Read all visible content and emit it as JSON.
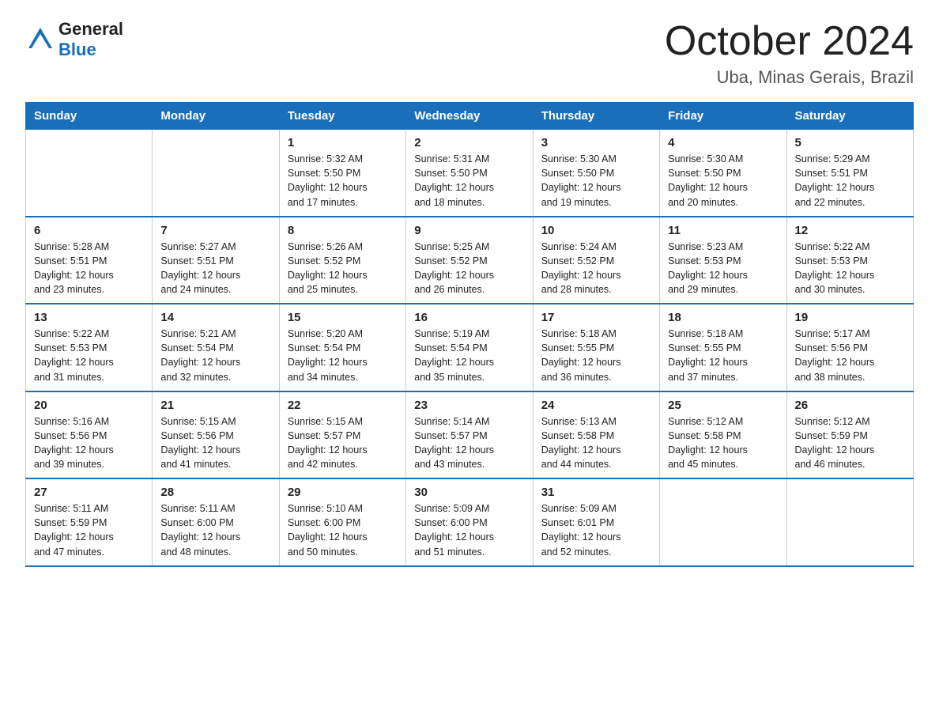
{
  "header": {
    "logo_general": "General",
    "logo_blue": "Blue",
    "title": "October 2024",
    "location": "Uba, Minas Gerais, Brazil"
  },
  "days_of_week": [
    "Sunday",
    "Monday",
    "Tuesday",
    "Wednesday",
    "Thursday",
    "Friday",
    "Saturday"
  ],
  "weeks": [
    [
      {
        "day": "",
        "info": ""
      },
      {
        "day": "",
        "info": ""
      },
      {
        "day": "1",
        "info": "Sunrise: 5:32 AM\nSunset: 5:50 PM\nDaylight: 12 hours\nand 17 minutes."
      },
      {
        "day": "2",
        "info": "Sunrise: 5:31 AM\nSunset: 5:50 PM\nDaylight: 12 hours\nand 18 minutes."
      },
      {
        "day": "3",
        "info": "Sunrise: 5:30 AM\nSunset: 5:50 PM\nDaylight: 12 hours\nand 19 minutes."
      },
      {
        "day": "4",
        "info": "Sunrise: 5:30 AM\nSunset: 5:50 PM\nDaylight: 12 hours\nand 20 minutes."
      },
      {
        "day": "5",
        "info": "Sunrise: 5:29 AM\nSunset: 5:51 PM\nDaylight: 12 hours\nand 22 minutes."
      }
    ],
    [
      {
        "day": "6",
        "info": "Sunrise: 5:28 AM\nSunset: 5:51 PM\nDaylight: 12 hours\nand 23 minutes."
      },
      {
        "day": "7",
        "info": "Sunrise: 5:27 AM\nSunset: 5:51 PM\nDaylight: 12 hours\nand 24 minutes."
      },
      {
        "day": "8",
        "info": "Sunrise: 5:26 AM\nSunset: 5:52 PM\nDaylight: 12 hours\nand 25 minutes."
      },
      {
        "day": "9",
        "info": "Sunrise: 5:25 AM\nSunset: 5:52 PM\nDaylight: 12 hours\nand 26 minutes."
      },
      {
        "day": "10",
        "info": "Sunrise: 5:24 AM\nSunset: 5:52 PM\nDaylight: 12 hours\nand 28 minutes."
      },
      {
        "day": "11",
        "info": "Sunrise: 5:23 AM\nSunset: 5:53 PM\nDaylight: 12 hours\nand 29 minutes."
      },
      {
        "day": "12",
        "info": "Sunrise: 5:22 AM\nSunset: 5:53 PM\nDaylight: 12 hours\nand 30 minutes."
      }
    ],
    [
      {
        "day": "13",
        "info": "Sunrise: 5:22 AM\nSunset: 5:53 PM\nDaylight: 12 hours\nand 31 minutes."
      },
      {
        "day": "14",
        "info": "Sunrise: 5:21 AM\nSunset: 5:54 PM\nDaylight: 12 hours\nand 32 minutes."
      },
      {
        "day": "15",
        "info": "Sunrise: 5:20 AM\nSunset: 5:54 PM\nDaylight: 12 hours\nand 34 minutes."
      },
      {
        "day": "16",
        "info": "Sunrise: 5:19 AM\nSunset: 5:54 PM\nDaylight: 12 hours\nand 35 minutes."
      },
      {
        "day": "17",
        "info": "Sunrise: 5:18 AM\nSunset: 5:55 PM\nDaylight: 12 hours\nand 36 minutes."
      },
      {
        "day": "18",
        "info": "Sunrise: 5:18 AM\nSunset: 5:55 PM\nDaylight: 12 hours\nand 37 minutes."
      },
      {
        "day": "19",
        "info": "Sunrise: 5:17 AM\nSunset: 5:56 PM\nDaylight: 12 hours\nand 38 minutes."
      }
    ],
    [
      {
        "day": "20",
        "info": "Sunrise: 5:16 AM\nSunset: 5:56 PM\nDaylight: 12 hours\nand 39 minutes."
      },
      {
        "day": "21",
        "info": "Sunrise: 5:15 AM\nSunset: 5:56 PM\nDaylight: 12 hours\nand 41 minutes."
      },
      {
        "day": "22",
        "info": "Sunrise: 5:15 AM\nSunset: 5:57 PM\nDaylight: 12 hours\nand 42 minutes."
      },
      {
        "day": "23",
        "info": "Sunrise: 5:14 AM\nSunset: 5:57 PM\nDaylight: 12 hours\nand 43 minutes."
      },
      {
        "day": "24",
        "info": "Sunrise: 5:13 AM\nSunset: 5:58 PM\nDaylight: 12 hours\nand 44 minutes."
      },
      {
        "day": "25",
        "info": "Sunrise: 5:12 AM\nSunset: 5:58 PM\nDaylight: 12 hours\nand 45 minutes."
      },
      {
        "day": "26",
        "info": "Sunrise: 5:12 AM\nSunset: 5:59 PM\nDaylight: 12 hours\nand 46 minutes."
      }
    ],
    [
      {
        "day": "27",
        "info": "Sunrise: 5:11 AM\nSunset: 5:59 PM\nDaylight: 12 hours\nand 47 minutes."
      },
      {
        "day": "28",
        "info": "Sunrise: 5:11 AM\nSunset: 6:00 PM\nDaylight: 12 hours\nand 48 minutes."
      },
      {
        "day": "29",
        "info": "Sunrise: 5:10 AM\nSunset: 6:00 PM\nDaylight: 12 hours\nand 50 minutes."
      },
      {
        "day": "30",
        "info": "Sunrise: 5:09 AM\nSunset: 6:00 PM\nDaylight: 12 hours\nand 51 minutes."
      },
      {
        "day": "31",
        "info": "Sunrise: 5:09 AM\nSunset: 6:01 PM\nDaylight: 12 hours\nand 52 minutes."
      },
      {
        "day": "",
        "info": ""
      },
      {
        "day": "",
        "info": ""
      }
    ]
  ]
}
